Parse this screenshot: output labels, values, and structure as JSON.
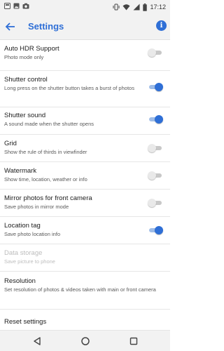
{
  "status_bar": {
    "time": "17:12",
    "left_icons": [
      "notification-icon",
      "image-icon",
      "camera-icon"
    ],
    "right_icons": [
      "vibrate-icon",
      "wifi-icon",
      "signal-icon",
      "battery-icon"
    ]
  },
  "app_bar": {
    "title": "Settings",
    "back_icon": "back-arrow-icon",
    "info_label": "i"
  },
  "settings": [
    {
      "title": "Auto HDR Support",
      "subtitle": "Photo mode only",
      "toggle": true,
      "on": false,
      "disabled": false
    },
    {
      "title": "Shutter control",
      "subtitle": "Long press on the shutter button takes a burst of photos",
      "toggle": true,
      "on": true,
      "disabled": false
    },
    {
      "title": "Shutter sound",
      "subtitle": "A sound made when the shutter opens",
      "toggle": true,
      "on": true,
      "disabled": false
    },
    {
      "title": "Grid",
      "subtitle": "Show the rule of thirds in viewfinder",
      "toggle": true,
      "on": false,
      "disabled": false
    },
    {
      "title": "Watermark",
      "subtitle": "Show time, location, weather or info",
      "toggle": true,
      "on": false,
      "disabled": false
    },
    {
      "title": "Mirror photos for front camera",
      "subtitle": "Save photos in mirror mode",
      "toggle": true,
      "on": false,
      "disabled": false
    },
    {
      "title": "Location tag",
      "subtitle": "Save photo location info",
      "toggle": true,
      "on": true,
      "disabled": false
    },
    {
      "title": "Data storage",
      "subtitle": "Save picture to phone",
      "toggle": false,
      "on": false,
      "disabled": true
    },
    {
      "title": "Resolution",
      "subtitle": "Set resolution of photos & videos taken with main or front camera",
      "toggle": false,
      "on": false,
      "disabled": false
    },
    {
      "title": "Reset settings",
      "subtitle": "",
      "toggle": false,
      "on": false,
      "disabled": false
    }
  ],
  "nav_bar": {
    "icons": [
      "back-triangle-icon",
      "home-circle-icon",
      "recents-square-icon"
    ]
  },
  "colors": {
    "accent": "#2f6fd6",
    "toggle_off_thumb": "#e9e9e9",
    "toggle_off_track": "#c8c8c8",
    "disabled_text": "#bdbdbd"
  }
}
